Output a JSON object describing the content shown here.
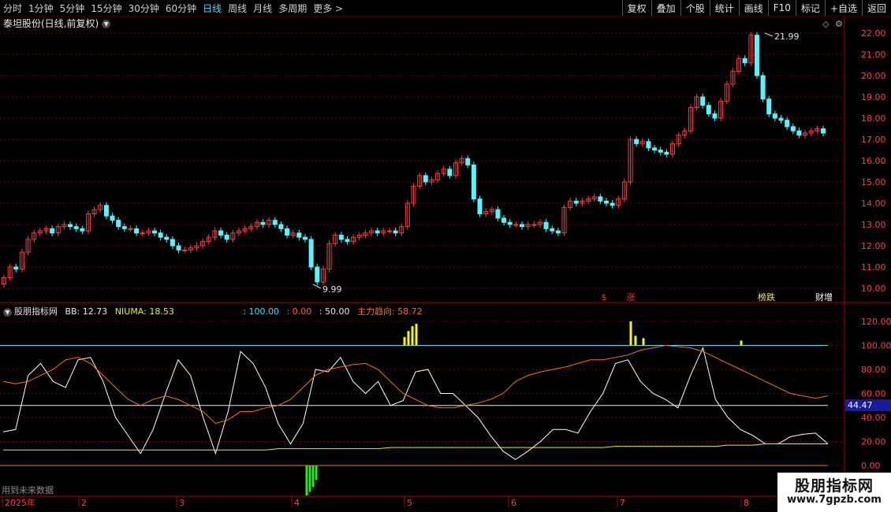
{
  "toolbar": {
    "periods": [
      "分时",
      "1分钟",
      "5分钟",
      "15分钟",
      "30分钟",
      "60分钟",
      "日线",
      "周线",
      "月线",
      "多周期",
      "更多 >"
    ],
    "active_period": "日线",
    "actions": [
      "复权",
      "叠加",
      "个股",
      "统计",
      "画线",
      "F10",
      "标记",
      "+自选",
      "返回"
    ]
  },
  "main_title": "泰坦股份(日线,前复权)",
  "price_axis": [
    "22.00",
    "21.00",
    "20.00",
    "19.00",
    "18.00",
    "17.00",
    "16.00",
    "15.00",
    "14.00",
    "13.00",
    "12.00",
    "11.00",
    "10.00"
  ],
  "annotations": {
    "high": "21.99",
    "low": "9.99"
  },
  "event_markers": [
    {
      "text": "$",
      "color": "#ff3030"
    },
    {
      "text": "涨",
      "color": "#ff3030"
    },
    {
      "text": "榜跌",
      "color": "#f0f000"
    },
    {
      "text": "财增",
      "color": "#ffffff"
    }
  ],
  "indicator": {
    "name": "股朋指标网",
    "bb": "BB: 12.73",
    "niuma": "NIUMA: 18.53",
    "v100": ": 100.00",
    "v0": ": 0.00",
    "v50": ": 50.00",
    "trend": "主力趋向: 58.72",
    "axis": [
      "120.00",
      "100.00",
      "80.00",
      "60.00",
      "40.00",
      "20.00",
      "0.00"
    ],
    "current": "44.47"
  },
  "footer_note": "用到未来数据",
  "date_axis": [
    "2025年",
    "2",
    "3",
    "4",
    "5",
    "6",
    "7",
    "8"
  ],
  "watermark": {
    "line1": "股朋指标网",
    "line2": "www.7gpzb.com"
  },
  "colors": {
    "up": "#ff3b3b",
    "down": "#54f5ff",
    "white_line": "#ffffff",
    "orange_line": "#ff6a2a",
    "yellow_line": "#f0f000",
    "cyan_line": "#39e0ff",
    "green_bar": "#29e629",
    "yellow_bar": "#f8f800"
  },
  "chart_data": [
    {
      "type": "candlestick",
      "title": "泰坦股份(日线,前复权)",
      "ylim": [
        10,
        22
      ],
      "y_ticks": [
        10,
        11,
        12,
        13,
        14,
        15,
        16,
        17,
        18,
        19,
        20,
        21,
        22
      ],
      "close": [
        10.5,
        11.0,
        10.9,
        11.7,
        12.3,
        12.6,
        12.7,
        12.8,
        12.6,
        12.9,
        13.0,
        12.9,
        12.8,
        12.7,
        13.5,
        13.7,
        13.9,
        13.4,
        13.2,
        12.9,
        12.8,
        12.8,
        12.6,
        12.6,
        12.7,
        12.6,
        12.4,
        12.3,
        12.0,
        11.8,
        11.8,
        11.9,
        12.0,
        12.2,
        12.4,
        12.7,
        12.5,
        12.3,
        12.6,
        12.7,
        12.8,
        12.9,
        13.1,
        13.0,
        13.2,
        13.0,
        12.8,
        12.5,
        12.6,
        12.4,
        12.3,
        11.0,
        10.3,
        10.9,
        12.1,
        12.5,
        12.3,
        12.2,
        12.4,
        12.5,
        12.6,
        12.7,
        12.6,
        12.7,
        12.7,
        12.6,
        12.9,
        14.0,
        14.8,
        15.3,
        15.0,
        15.1,
        15.4,
        15.6,
        15.3,
        15.9,
        16.1,
        15.8,
        14.2,
        13.5,
        13.6,
        13.7,
        13.3,
        13.1,
        13.0,
        13.0,
        12.9,
        13.0,
        13.0,
        13.1,
        12.8,
        12.7,
        12.6,
        13.8,
        14.1,
        14.0,
        14.1,
        14.2,
        14.3,
        14.1,
        14.0,
        13.9,
        14.2,
        15.0,
        17.0,
        16.8,
        16.9,
        16.6,
        16.5,
        16.4,
        16.3,
        16.8,
        17.2,
        17.4,
        18.5,
        19.0,
        18.6,
        18.2,
        18.0,
        18.8,
        19.6,
        20.2,
        20.8,
        20.6,
        21.9,
        20.0,
        18.9,
        18.2,
        18.0,
        17.9,
        17.6,
        17.4,
        17.2,
        17.3,
        17.4,
        17.5,
        17.3
      ]
    },
    {
      "type": "line",
      "title": "股朋指标网",
      "ylim": [
        -10,
        130
      ],
      "y_ticks": [
        0,
        20,
        40,
        60,
        80,
        100,
        120
      ],
      "hlines": [
        {
          "name": "100",
          "value": 100
        },
        {
          "name": "50",
          "value": 50
        },
        {
          "name": "0",
          "value": 0
        }
      ],
      "series": [
        {
          "name": "BB",
          "values": [
            28,
            30,
            75,
            85,
            70,
            65,
            88,
            90,
            70,
            40,
            25,
            10,
            30,
            60,
            88,
            75,
            40,
            10,
            45,
            95,
            85,
            65,
            35,
            18,
            35,
            80,
            78,
            90,
            70,
            60,
            70,
            50,
            54,
            78,
            80,
            60,
            60,
            50,
            40,
            25,
            12,
            5,
            12,
            20,
            30,
            30,
            27,
            45,
            60,
            85,
            88,
            70,
            60,
            55,
            48,
            75,
            98,
            55,
            40,
            30,
            25,
            18,
            18,
            24,
            26,
            27,
            18
          ]
        },
        {
          "name": "NIUMA",
          "values": [
            13,
            13,
            13,
            13,
            13,
            13,
            13,
            13,
            13,
            13,
            13,
            13,
            13,
            13,
            13,
            13,
            13,
            13,
            13,
            13,
            13,
            13,
            14,
            14,
            14,
            14,
            14,
            14,
            14,
            14,
            14,
            15,
            15,
            15,
            15,
            15,
            15,
            15,
            15,
            15,
            15,
            15,
            15,
            15,
            15,
            15,
            15,
            15,
            15,
            16,
            16,
            16,
            16,
            16,
            16,
            16,
            16,
            16,
            17,
            17,
            17,
            18,
            18,
            18,
            18,
            18,
            18
          ]
        },
        {
          "name": "主力趋向",
          "values": [
            70,
            68,
            70,
            75,
            80,
            88,
            90,
            85,
            75,
            65,
            55,
            50,
            55,
            58,
            55,
            50,
            45,
            35,
            38,
            45,
            45,
            48,
            50,
            55,
            65,
            75,
            80,
            82,
            84,
            85,
            80,
            70,
            60,
            55,
            50,
            48,
            48,
            50,
            52,
            55,
            60,
            70,
            75,
            78,
            80,
            82,
            85,
            88,
            88,
            90,
            92,
            96,
            98,
            100,
            99,
            98,
            95,
            90,
            85,
            80,
            75,
            70,
            65,
            60,
            58,
            56,
            58
          ]
        }
      ]
    }
  ]
}
